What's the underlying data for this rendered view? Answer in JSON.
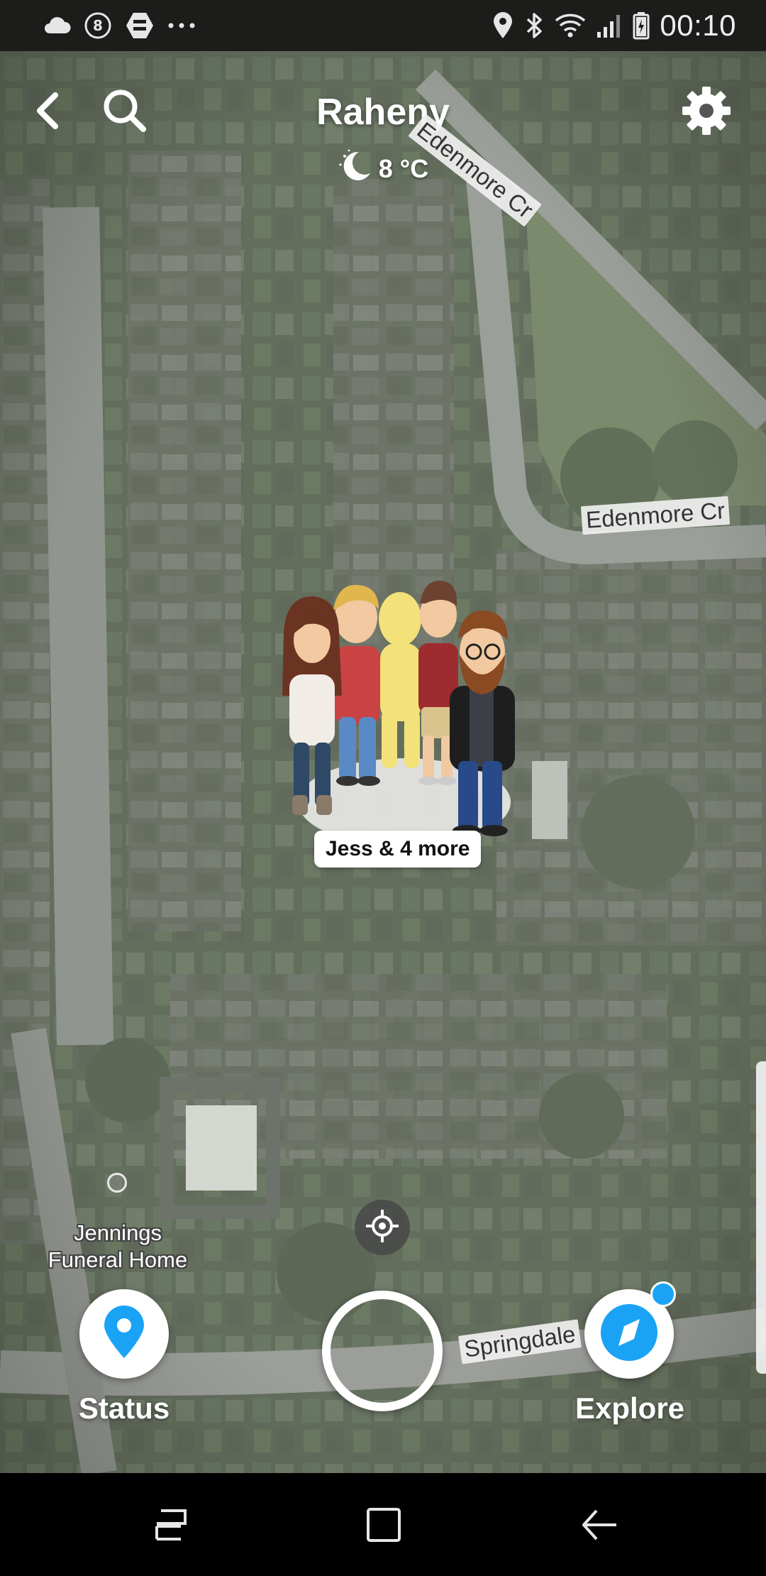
{
  "status_bar": {
    "time": "00:10",
    "left_icons": [
      "cloud-icon",
      "notification-8-icon",
      "app-icon",
      "more-dots-icon"
    ],
    "right_icons": [
      "location-icon",
      "bluetooth-icon",
      "wifi-icon",
      "signal-icon",
      "battery-icon"
    ]
  },
  "header": {
    "place": "Raheny",
    "weather": {
      "icon": "moon-icon",
      "temperature": "8 °C"
    }
  },
  "map": {
    "streets": [
      "Edenmore Cr",
      "Edenmore Cr",
      "Springdale"
    ],
    "poi": {
      "name_line1": "Jennings",
      "name_line2": "Funeral Home"
    }
  },
  "friends": {
    "label": "Jess & 4 more"
  },
  "bottom": {
    "status_label": "Status",
    "explore_label": "Explore"
  },
  "colors": {
    "accent": "#1aa3f5",
    "status_bar_bg": "#1c1d1b",
    "nav_bar_bg": "#000000"
  }
}
